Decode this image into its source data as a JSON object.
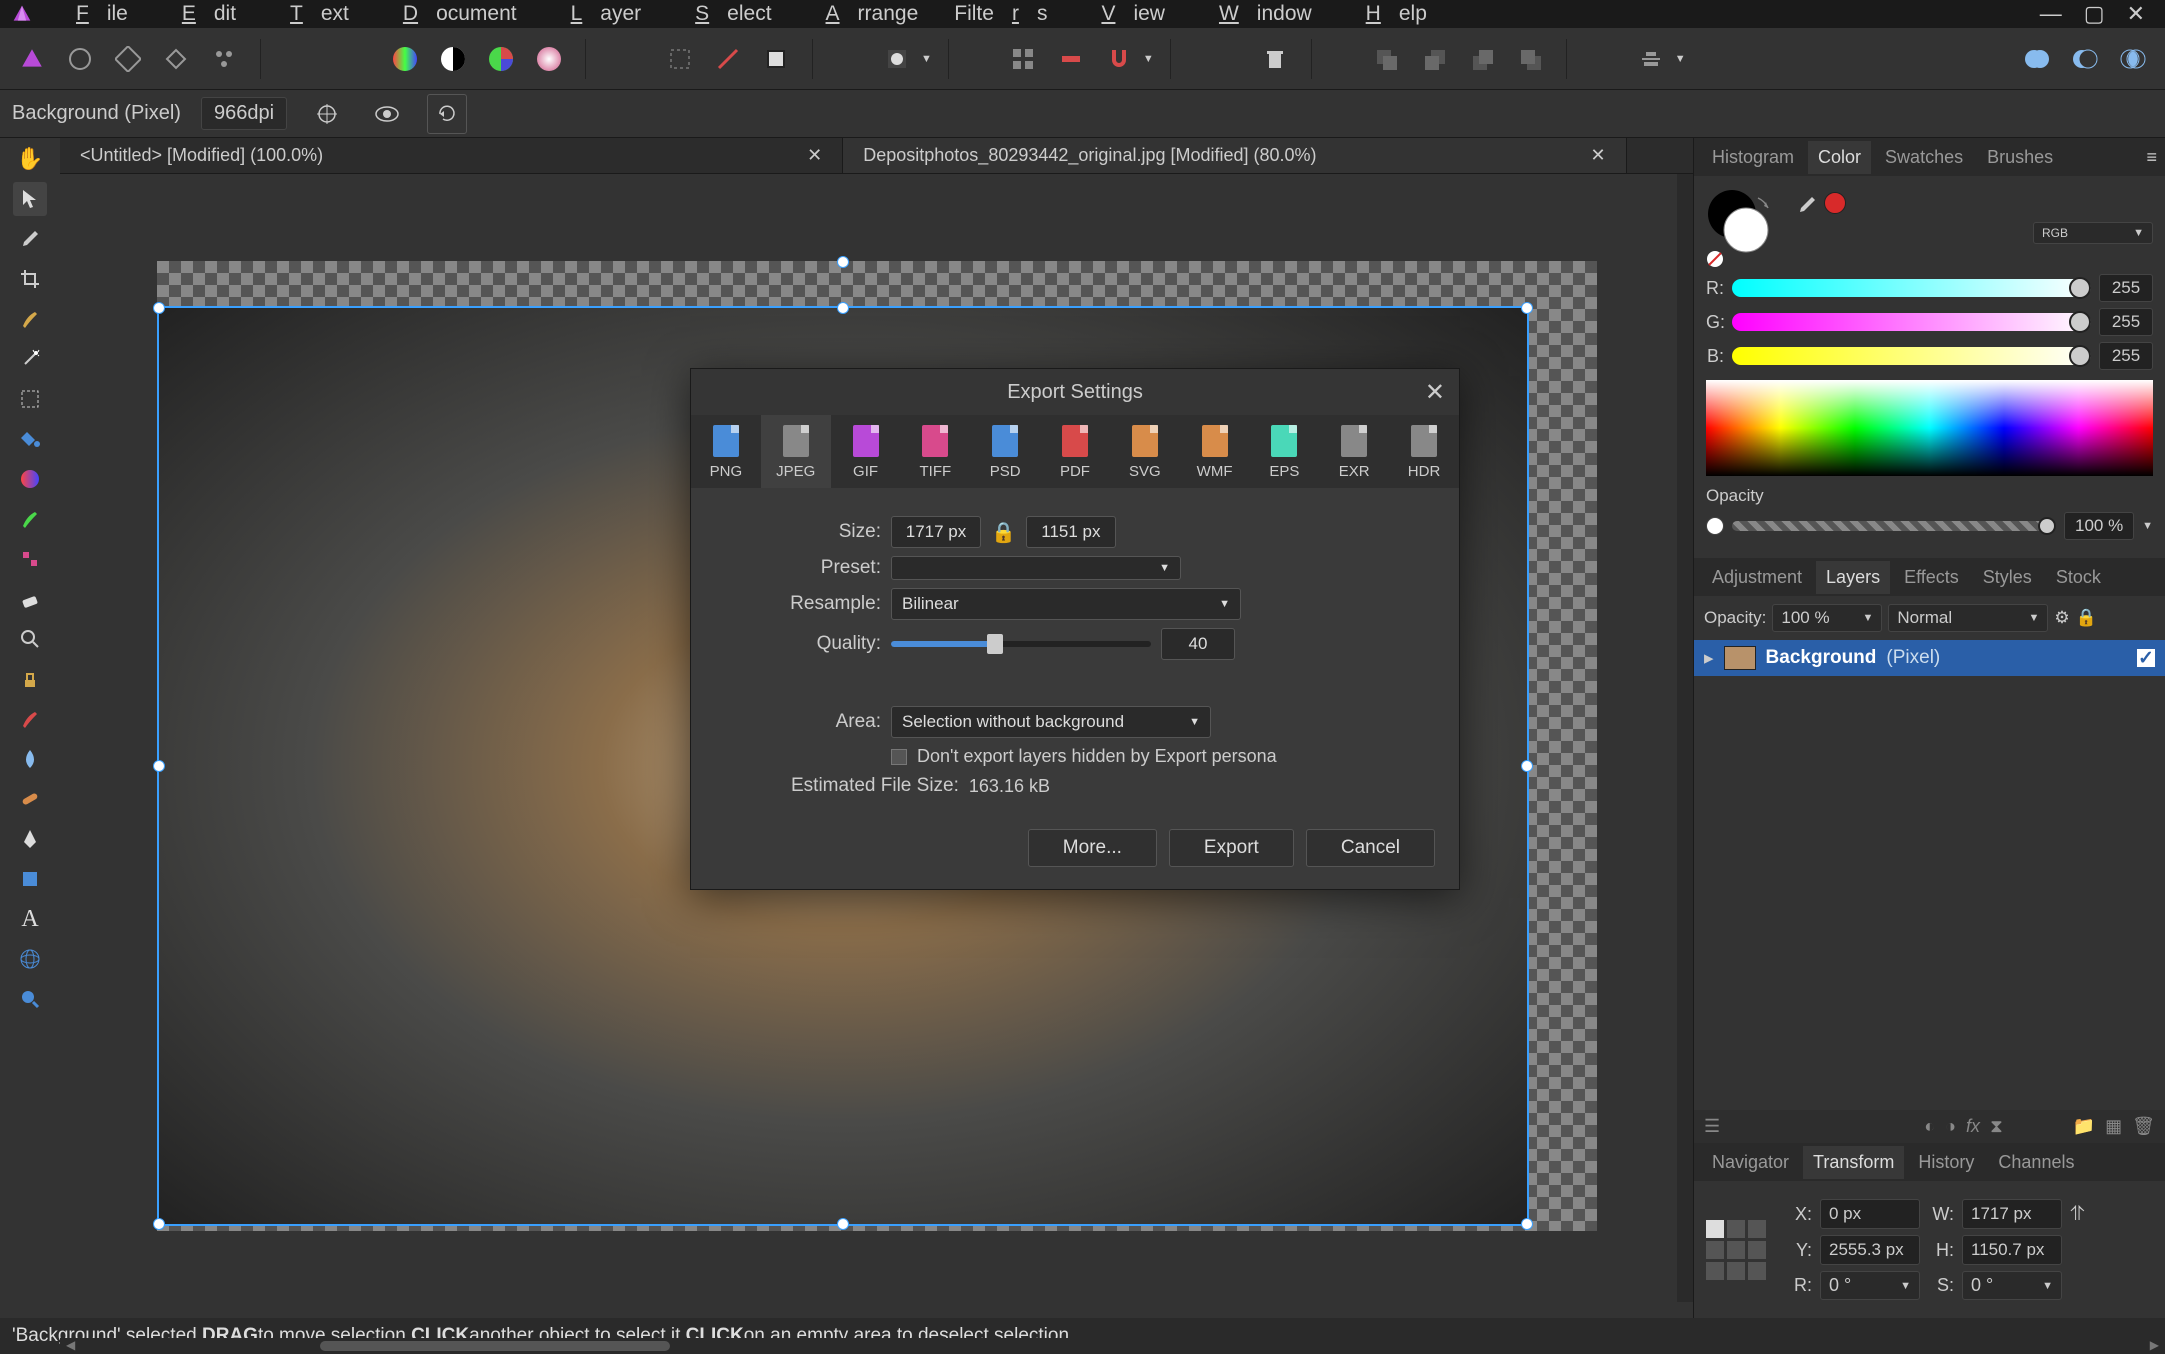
{
  "menu": {
    "items": [
      "File",
      "Edit",
      "Text",
      "Document",
      "Layer",
      "Select",
      "Arrange",
      "Filters",
      "View",
      "Window",
      "Help"
    ]
  },
  "context": {
    "layer_info": "Background (Pixel)",
    "dpi": "966dpi"
  },
  "tabs": [
    {
      "title": "<Untitled> [Modified] (100.0%)"
    },
    {
      "title": "Depositphotos_80293442_original.jpg [Modified] (80.0%)"
    }
  ],
  "panels": {
    "top_tabs": [
      "Histogram",
      "Color",
      "Swatches",
      "Brushes"
    ],
    "color_mode": "RGB",
    "r": "255",
    "g": "255",
    "b": "255",
    "opacity_label": "Opacity",
    "opacity_value": "100 %",
    "mid_tabs": [
      "Adjustment",
      "Layers",
      "Effects",
      "Styles",
      "Stock"
    ],
    "layer_opacity_label": "Opacity:",
    "layer_opacity": "100 %",
    "blend_mode": "Normal",
    "layer_name": "Background",
    "layer_type": "(Pixel)",
    "bottom_tabs": [
      "Navigator",
      "Transform",
      "History",
      "Channels"
    ],
    "tf": {
      "x_label": "X:",
      "x": "0 px",
      "y_label": "Y:",
      "y": "2555.3 px",
      "w_label": "W:",
      "w": "1717 px",
      "h_label": "H:",
      "h": "1150.7 px",
      "r_label": "R:",
      "r": "0 °",
      "s_label": "S:",
      "s": "0 °"
    }
  },
  "dialog": {
    "title": "Export Settings",
    "formats": [
      "PNG",
      "JPEG",
      "GIF",
      "TIFF",
      "PSD",
      "PDF",
      "SVG",
      "WMF",
      "EPS",
      "EXR",
      "HDR"
    ],
    "format_colors": [
      "#4a8cd8",
      "#888",
      "#b84ad8",
      "#d84a8c",
      "#4a8cd8",
      "#d84a4a",
      "#d88c4a",
      "#d88c4a",
      "#4ad8b8",
      "#888",
      "#888"
    ],
    "size_label": "Size:",
    "size_w": "1717 px",
    "size_h": "1151 px",
    "preset_label": "Preset:",
    "preset_value": "",
    "resample_label": "Resample:",
    "resample_value": "Bilinear",
    "quality_label": "Quality:",
    "quality_value": "40",
    "area_label": "Area:",
    "area_value": "Selection without background",
    "checkbox_label": "Don't export layers hidden by Export persona",
    "est_label": "Estimated File Size:",
    "est_value": "163.16 kB",
    "more": "More...",
    "export": "Export",
    "cancel": "Cancel"
  },
  "status": {
    "t1": "'Background' selected. ",
    "t2": "DRAG",
    "t3": " to move selection. ",
    "t4": "CLICK",
    "t5": " another object to select it. ",
    "t6": "CLICK",
    "t7": " on an empty area to deselect selection."
  }
}
